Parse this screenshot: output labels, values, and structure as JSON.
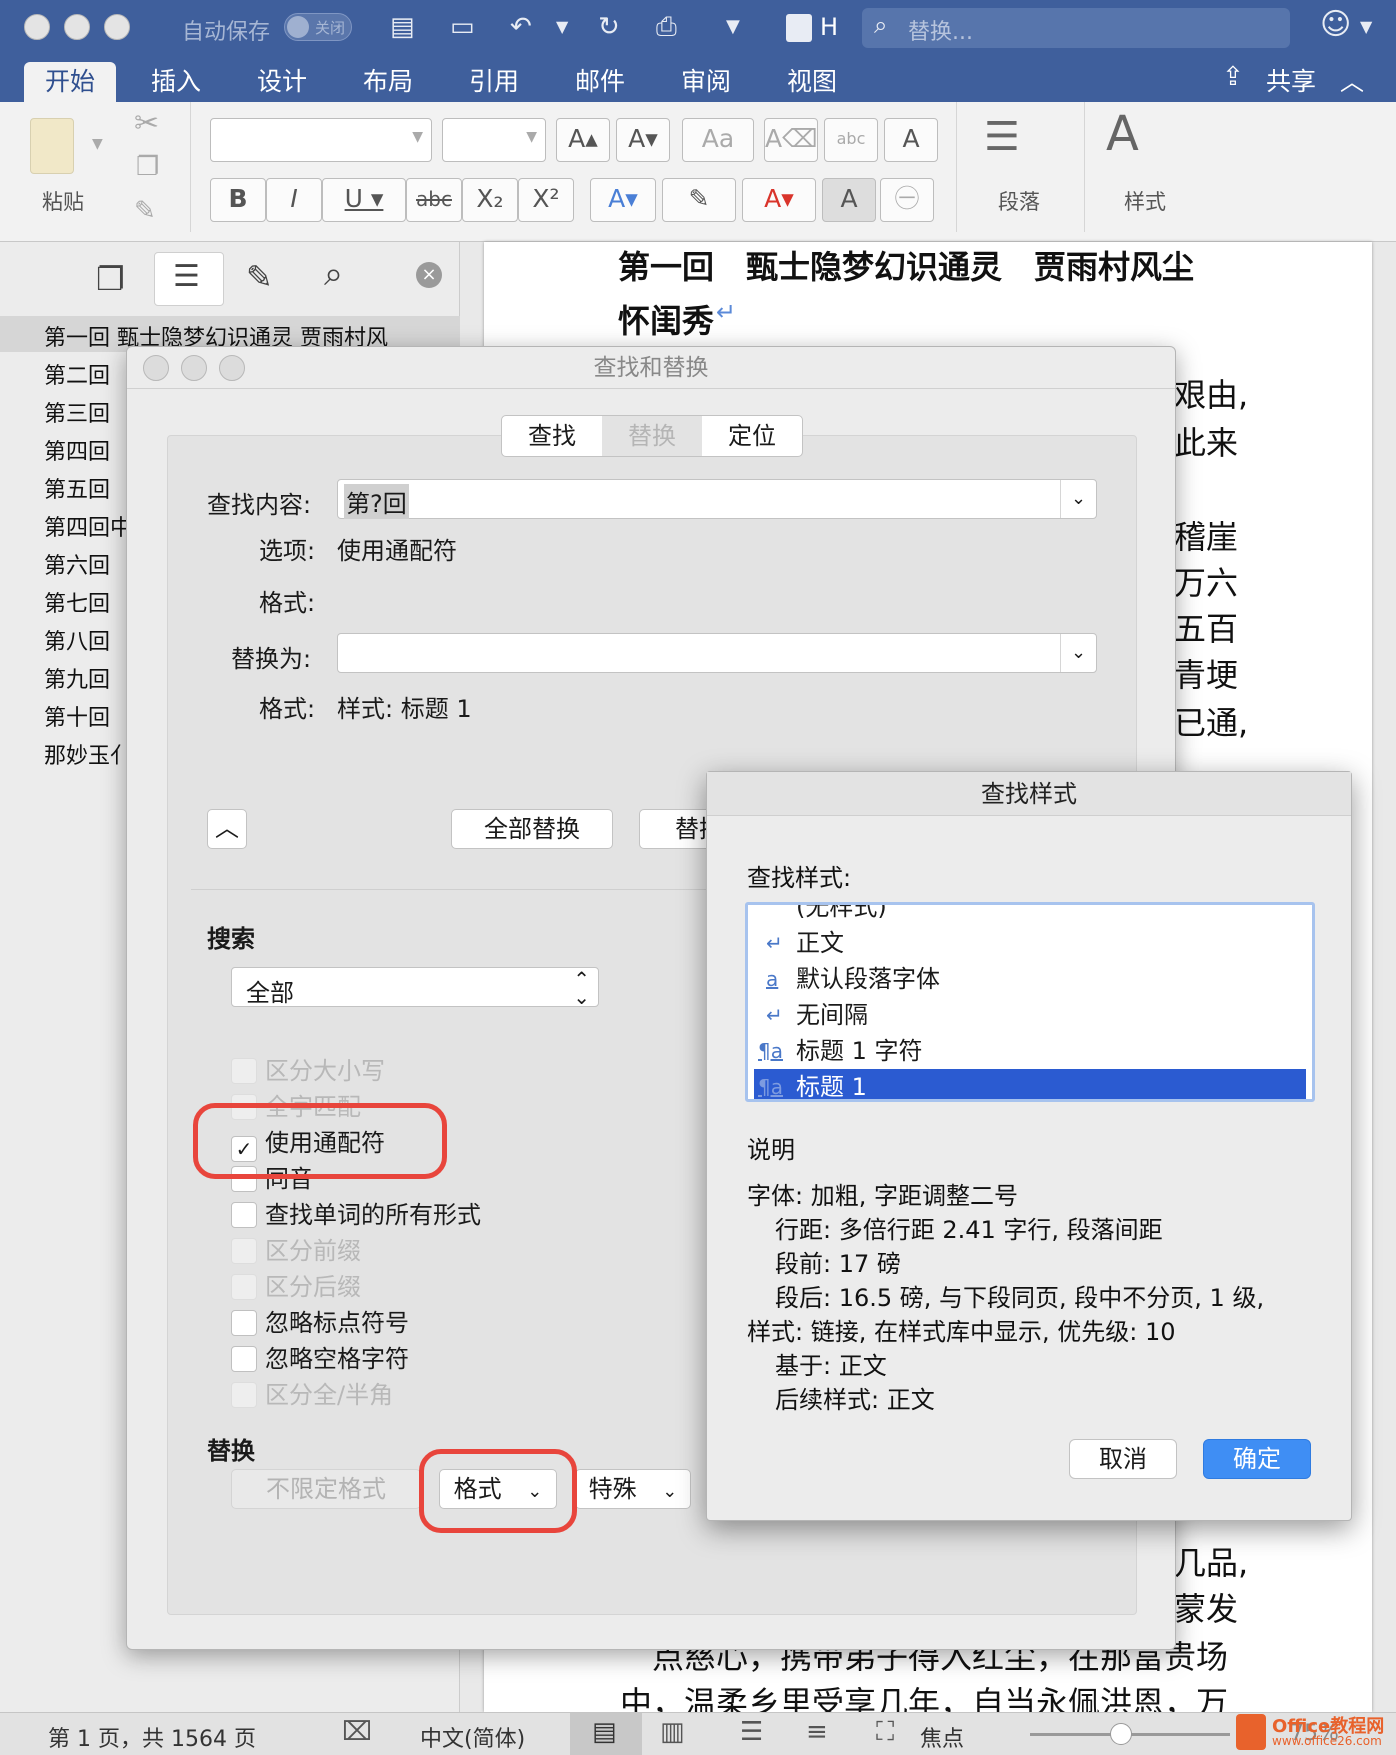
{
  "titlebar": {
    "autosave_label": "自动保存",
    "autosave_state": "关闭",
    "doc_initial": "H",
    "search_placeholder": "替换..."
  },
  "ribbon_tabs": [
    "开始",
    "插入",
    "设计",
    "布局",
    "引用",
    "邮件",
    "审阅",
    "视图"
  ],
  "share_label": "共享",
  "ribbon": {
    "paste_label": "粘贴",
    "paragraph_label": "段落",
    "styles_label": "样式"
  },
  "nav_items": [
    "第一回  甄士隐梦幻识通灵 贾雨村风",
    "第二回",
    "第三回",
    "第四回",
    "第五回",
    "第四回中",
    "第六回",
    "第七回",
    "第八回",
    "第九回",
    "第十回",
    "那妙玉亻"
  ],
  "document": {
    "heading_line1": "第一回　甄士隐梦幻识通灵　贾雨村风尘",
    "heading_line2": "怀闺秀",
    "right_fragments": [
      "艰由,",
      "此来",
      "稽崖",
      "万六",
      "五百",
      "青埂",
      "已通,",
      "几品,",
      "蒙发"
    ],
    "bottom_line1": "点慈心，携带弟子得入红尘，在那富贵场",
    "bottom_line2": "中，温柔乡里受享几年，自当永佩洪恩，万"
  },
  "find_replace": {
    "title": "查找和替换",
    "tabs": [
      "查找",
      "替换",
      "定位"
    ],
    "find_label": "查找内容:",
    "find_value": "第?回",
    "options_label": "选项:",
    "options_value": "使用通配符",
    "format_label": "格式:",
    "replace_label": "替换为:",
    "replace_value": "",
    "replace_format_value": "样式: 标题 1",
    "replace_all": "全部替换",
    "replace_btn": "替换",
    "search_heading": "搜索",
    "search_scope": "全部",
    "checkboxes": [
      {
        "label": "区分大小写",
        "checked": false,
        "enabled": false
      },
      {
        "label": "全字匹配",
        "checked": false,
        "enabled": false
      },
      {
        "label": "使用通配符",
        "checked": true,
        "enabled": true
      },
      {
        "label": "同音",
        "checked": false,
        "enabled": true
      },
      {
        "label": "查找单词的所有形式",
        "checked": false,
        "enabled": true
      },
      {
        "label": "区分前缀",
        "checked": false,
        "enabled": false
      },
      {
        "label": "区分后缀",
        "checked": false,
        "enabled": false
      },
      {
        "label": "忽略标点符号",
        "checked": false,
        "enabled": true
      },
      {
        "label": "忽略空格字符",
        "checked": false,
        "enabled": true
      },
      {
        "label": "区分全/半角",
        "checked": false,
        "enabled": false
      }
    ],
    "replace_heading": "替换",
    "no_format": "不限定格式",
    "format_btn": "格式",
    "special_btn": "特殊"
  },
  "style_dialog": {
    "title": "查找样式",
    "list_label": "查找样式:",
    "items": [
      {
        "label": "(无样式)",
        "mark": ""
      },
      {
        "label": "正文",
        "mark": "↵"
      },
      {
        "label": "默认段落字体",
        "mark": "a"
      },
      {
        "label": "无间隔",
        "mark": "↵"
      },
      {
        "label": "标题 1 字符",
        "mark": "¶a"
      },
      {
        "label": "标题 1",
        "mark": "¶a"
      }
    ],
    "desc_heading": "说明",
    "desc_lines": [
      "字体: 加粗, 字距调整二号",
      "行距: 多倍行距 2.41 字行, 段落间距",
      "段前: 17 磅",
      "段后: 16.5 磅, 与下段同页, 段中不分页, 1 级,",
      "样式: 链接, 在样式库中显示, 优先级: 10",
      "基于: 正文",
      "后续样式: 正文"
    ],
    "cancel": "取消",
    "ok": "确定"
  },
  "status": {
    "page_info": "第 1 页，共 1564 页",
    "language": "中文(简体)",
    "focus": "焦点",
    "zoom": "75%"
  },
  "watermark": {
    "brand": "Office教程网",
    "url": "www.office26.com"
  }
}
